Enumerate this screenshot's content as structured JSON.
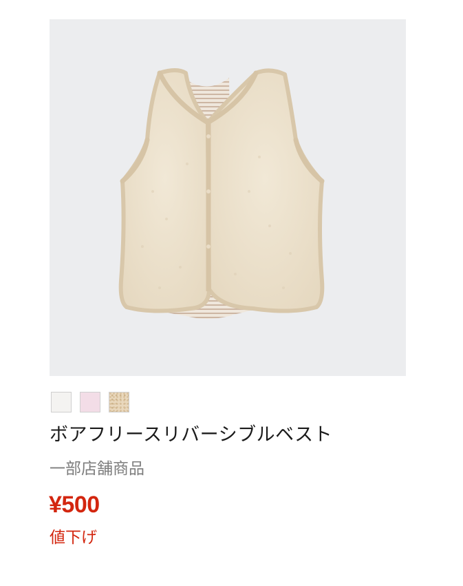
{
  "product": {
    "name": "ボアフリースリバーシブルベスト",
    "availability": "一部店舗商品",
    "price": "¥500",
    "price_flag": "値下げ",
    "favorite_icon": "heart-outline-icon",
    "image_description_icon": "fleece-vest-image",
    "colors": {
      "price": "#d3260f",
      "image_background": "#ecedef"
    },
    "swatches": [
      {
        "name": "off-white",
        "color": "#f4f3f1"
      },
      {
        "name": "pink",
        "color": "#f3dde7"
      },
      {
        "name": "beige",
        "color": "#e6d3b8"
      }
    ]
  }
}
